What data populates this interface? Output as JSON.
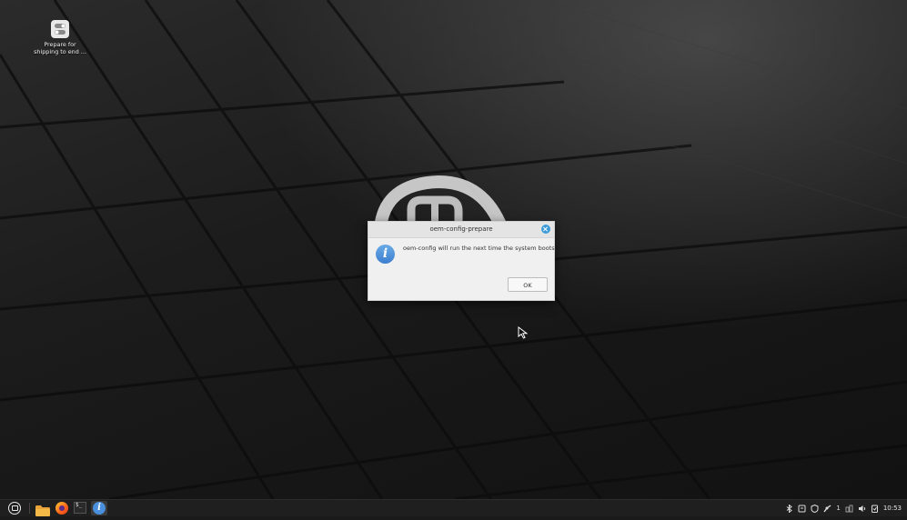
{
  "desktop": {
    "icons": [
      {
        "name": "toggle-settings-icon",
        "label_line1": "Prepare for",
        "label_line2": "shipping to end ..."
      }
    ],
    "wallpaper_logo": "linux-mint-logo"
  },
  "dialog": {
    "title": "oem-config-prepare",
    "message": "oem-config will run the next time the system boots.",
    "ok_label": "OK",
    "icon": "info-icon",
    "close_icon": "close-icon"
  },
  "taskbar": {
    "menu_icon": "mint-menu-icon",
    "launchers": [
      "folder-icon",
      "firefox-icon",
      "terminal-icon"
    ],
    "active_window_icon": "info-icon",
    "tray": {
      "workspace": "1",
      "clock": "10:53"
    }
  },
  "colors": {
    "accent": "#3d9bd8",
    "dialog_bg": "#f0f0f0",
    "taskbar_bg": "#1f1f1f"
  }
}
